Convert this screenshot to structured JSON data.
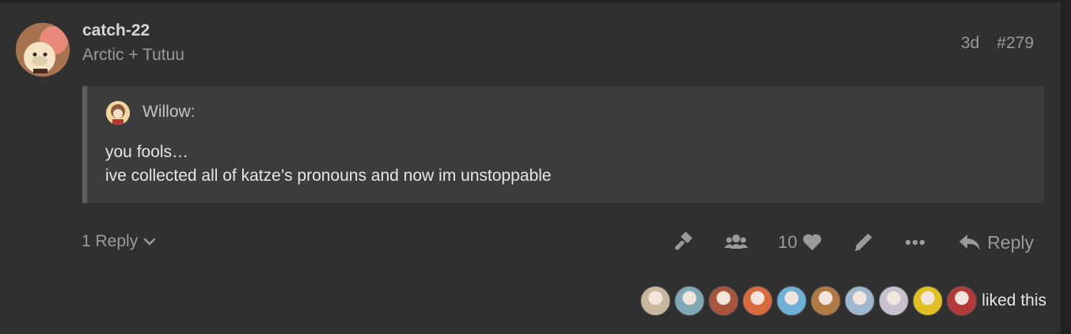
{
  "post": {
    "username": "catch-22",
    "user_title": "Arctic + Tutuu",
    "age": "3d",
    "number": "#279",
    "avatar_icon": "anime-avatar-icon"
  },
  "quote": {
    "author": "Willow:",
    "lines": [
      "you fools…",
      "ive collected all of katze’s pronouns and now im unstoppable"
    ]
  },
  "footer": {
    "replies_label": "1 Reply",
    "like_count": "10",
    "reply_label": "Reply",
    "icons": [
      "hammer-icon",
      "users-icon",
      "heart-icon",
      "pencil-icon",
      "more-icon",
      "reply-icon"
    ]
  },
  "likes": {
    "text": "liked this",
    "avatar_colors": [
      "#c7b89e",
      "#7fa9b5",
      "#a8553d",
      "#d96a3b",
      "#6fb0d6",
      "#b07a45",
      "#9fb8cf",
      "#c9c0cf",
      "#e0c020",
      "#b43a3a"
    ]
  },
  "colors": {
    "background": "#303030",
    "quote_background": "#3c3c3c",
    "text": "#e6e6e6",
    "muted": "#9a9a9a"
  }
}
